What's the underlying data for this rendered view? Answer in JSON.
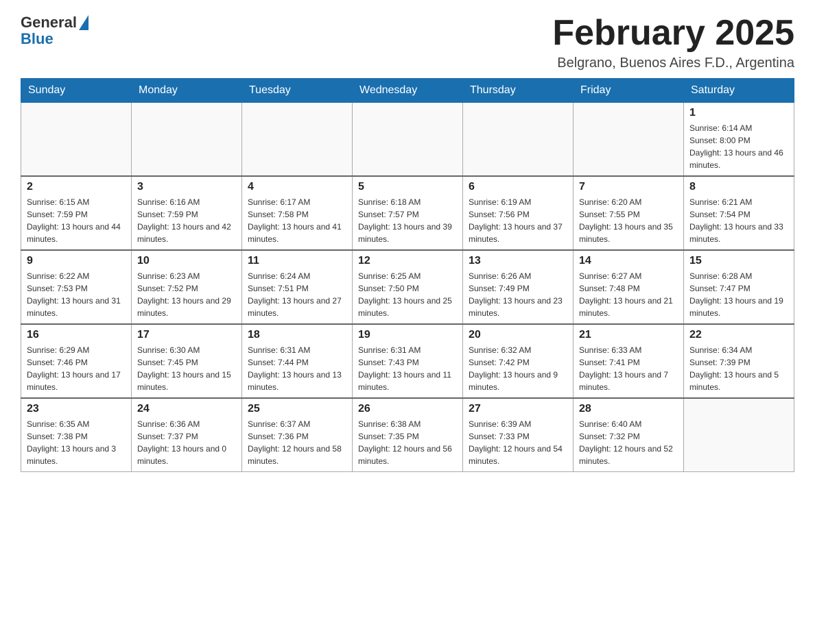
{
  "header": {
    "logo_general": "General",
    "logo_blue": "Blue",
    "month_title": "February 2025",
    "location": "Belgrano, Buenos Aires F.D., Argentina"
  },
  "days_of_week": [
    "Sunday",
    "Monday",
    "Tuesday",
    "Wednesday",
    "Thursday",
    "Friday",
    "Saturday"
  ],
  "weeks": [
    {
      "days": [
        {
          "number": "",
          "info": ""
        },
        {
          "number": "",
          "info": ""
        },
        {
          "number": "",
          "info": ""
        },
        {
          "number": "",
          "info": ""
        },
        {
          "number": "",
          "info": ""
        },
        {
          "number": "",
          "info": ""
        },
        {
          "number": "1",
          "info": "Sunrise: 6:14 AM\nSunset: 8:00 PM\nDaylight: 13 hours and 46 minutes."
        }
      ]
    },
    {
      "days": [
        {
          "number": "2",
          "info": "Sunrise: 6:15 AM\nSunset: 7:59 PM\nDaylight: 13 hours and 44 minutes."
        },
        {
          "number": "3",
          "info": "Sunrise: 6:16 AM\nSunset: 7:59 PM\nDaylight: 13 hours and 42 minutes."
        },
        {
          "number": "4",
          "info": "Sunrise: 6:17 AM\nSunset: 7:58 PM\nDaylight: 13 hours and 41 minutes."
        },
        {
          "number": "5",
          "info": "Sunrise: 6:18 AM\nSunset: 7:57 PM\nDaylight: 13 hours and 39 minutes."
        },
        {
          "number": "6",
          "info": "Sunrise: 6:19 AM\nSunset: 7:56 PM\nDaylight: 13 hours and 37 minutes."
        },
        {
          "number": "7",
          "info": "Sunrise: 6:20 AM\nSunset: 7:55 PM\nDaylight: 13 hours and 35 minutes."
        },
        {
          "number": "8",
          "info": "Sunrise: 6:21 AM\nSunset: 7:54 PM\nDaylight: 13 hours and 33 minutes."
        }
      ]
    },
    {
      "days": [
        {
          "number": "9",
          "info": "Sunrise: 6:22 AM\nSunset: 7:53 PM\nDaylight: 13 hours and 31 minutes."
        },
        {
          "number": "10",
          "info": "Sunrise: 6:23 AM\nSunset: 7:52 PM\nDaylight: 13 hours and 29 minutes."
        },
        {
          "number": "11",
          "info": "Sunrise: 6:24 AM\nSunset: 7:51 PM\nDaylight: 13 hours and 27 minutes."
        },
        {
          "number": "12",
          "info": "Sunrise: 6:25 AM\nSunset: 7:50 PM\nDaylight: 13 hours and 25 minutes."
        },
        {
          "number": "13",
          "info": "Sunrise: 6:26 AM\nSunset: 7:49 PM\nDaylight: 13 hours and 23 minutes."
        },
        {
          "number": "14",
          "info": "Sunrise: 6:27 AM\nSunset: 7:48 PM\nDaylight: 13 hours and 21 minutes."
        },
        {
          "number": "15",
          "info": "Sunrise: 6:28 AM\nSunset: 7:47 PM\nDaylight: 13 hours and 19 minutes."
        }
      ]
    },
    {
      "days": [
        {
          "number": "16",
          "info": "Sunrise: 6:29 AM\nSunset: 7:46 PM\nDaylight: 13 hours and 17 minutes."
        },
        {
          "number": "17",
          "info": "Sunrise: 6:30 AM\nSunset: 7:45 PM\nDaylight: 13 hours and 15 minutes."
        },
        {
          "number": "18",
          "info": "Sunrise: 6:31 AM\nSunset: 7:44 PM\nDaylight: 13 hours and 13 minutes."
        },
        {
          "number": "19",
          "info": "Sunrise: 6:31 AM\nSunset: 7:43 PM\nDaylight: 13 hours and 11 minutes."
        },
        {
          "number": "20",
          "info": "Sunrise: 6:32 AM\nSunset: 7:42 PM\nDaylight: 13 hours and 9 minutes."
        },
        {
          "number": "21",
          "info": "Sunrise: 6:33 AM\nSunset: 7:41 PM\nDaylight: 13 hours and 7 minutes."
        },
        {
          "number": "22",
          "info": "Sunrise: 6:34 AM\nSunset: 7:39 PM\nDaylight: 13 hours and 5 minutes."
        }
      ]
    },
    {
      "days": [
        {
          "number": "23",
          "info": "Sunrise: 6:35 AM\nSunset: 7:38 PM\nDaylight: 13 hours and 3 minutes."
        },
        {
          "number": "24",
          "info": "Sunrise: 6:36 AM\nSunset: 7:37 PM\nDaylight: 13 hours and 0 minutes."
        },
        {
          "number": "25",
          "info": "Sunrise: 6:37 AM\nSunset: 7:36 PM\nDaylight: 12 hours and 58 minutes."
        },
        {
          "number": "26",
          "info": "Sunrise: 6:38 AM\nSunset: 7:35 PM\nDaylight: 12 hours and 56 minutes."
        },
        {
          "number": "27",
          "info": "Sunrise: 6:39 AM\nSunset: 7:33 PM\nDaylight: 12 hours and 54 minutes."
        },
        {
          "number": "28",
          "info": "Sunrise: 6:40 AM\nSunset: 7:32 PM\nDaylight: 12 hours and 52 minutes."
        },
        {
          "number": "",
          "info": ""
        }
      ]
    }
  ]
}
